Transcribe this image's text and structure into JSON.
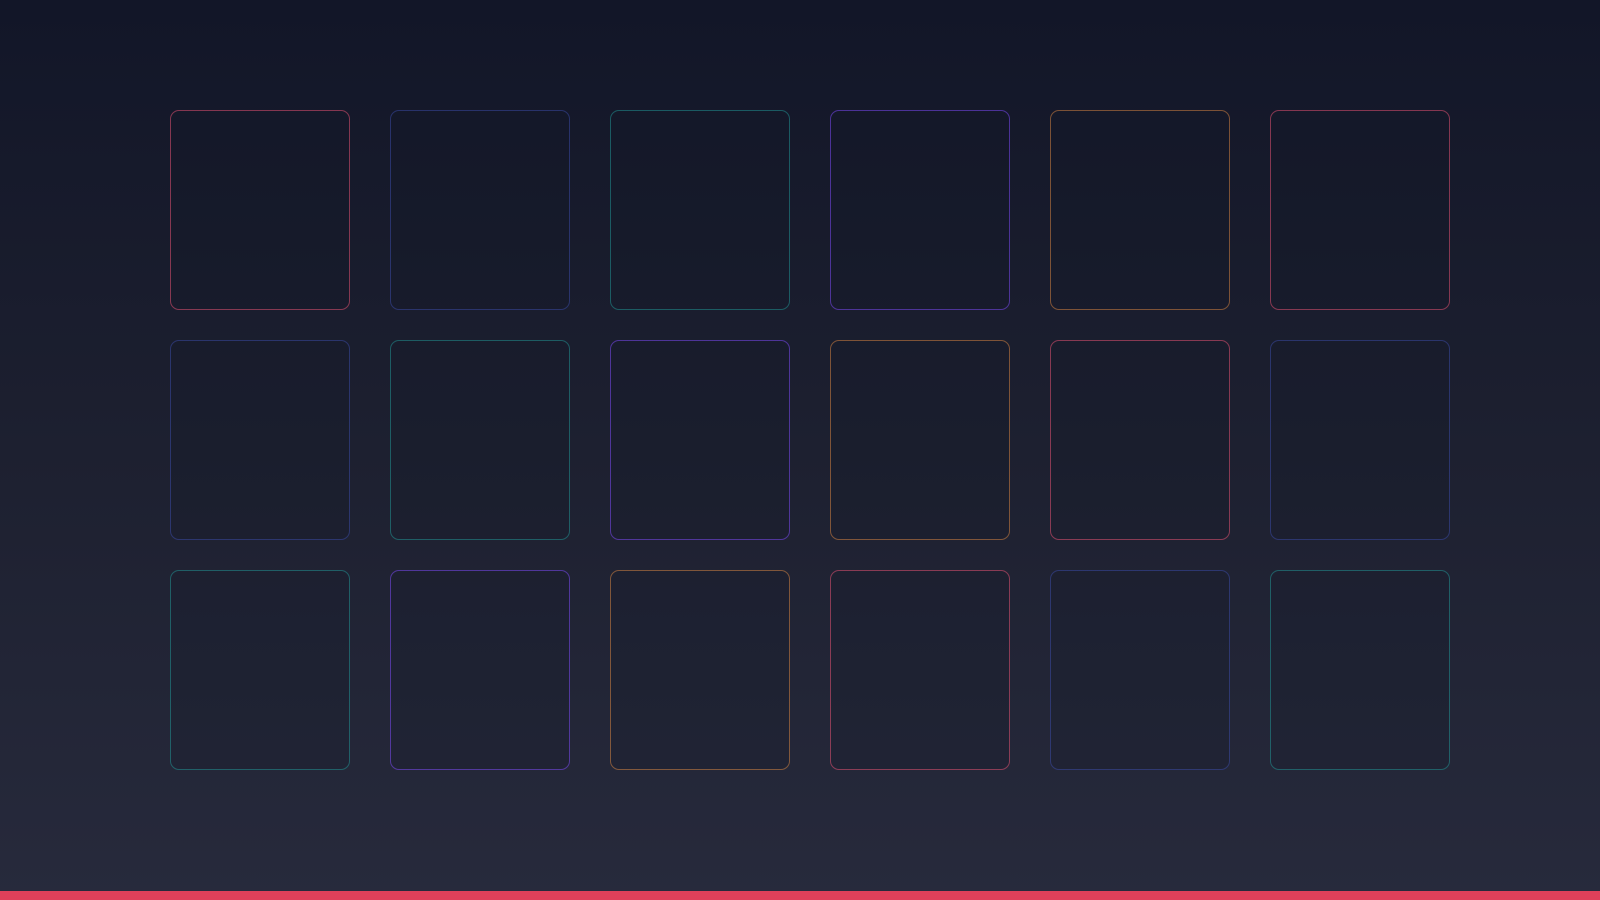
{
  "theme": {
    "accent": "#e0405a",
    "tile_colors": {
      "red": "#e05070",
      "blue": "#3848a0",
      "teal": "#209090",
      "purple": "#7848f0",
      "orange": "#d08040"
    }
  },
  "grid": {
    "tiles": [
      {
        "color": "red"
      },
      {
        "color": "blue"
      },
      {
        "color": "teal"
      },
      {
        "color": "purple"
      },
      {
        "color": "orange"
      },
      {
        "color": "red"
      },
      {
        "color": "blue"
      },
      {
        "color": "teal"
      },
      {
        "color": "purple"
      },
      {
        "color": "orange"
      },
      {
        "color": "red"
      },
      {
        "color": "blue"
      },
      {
        "color": "teal"
      },
      {
        "color": "purple"
      },
      {
        "color": "orange"
      },
      {
        "color": "red"
      },
      {
        "color": "blue"
      },
      {
        "color": "teal"
      }
    ]
  }
}
